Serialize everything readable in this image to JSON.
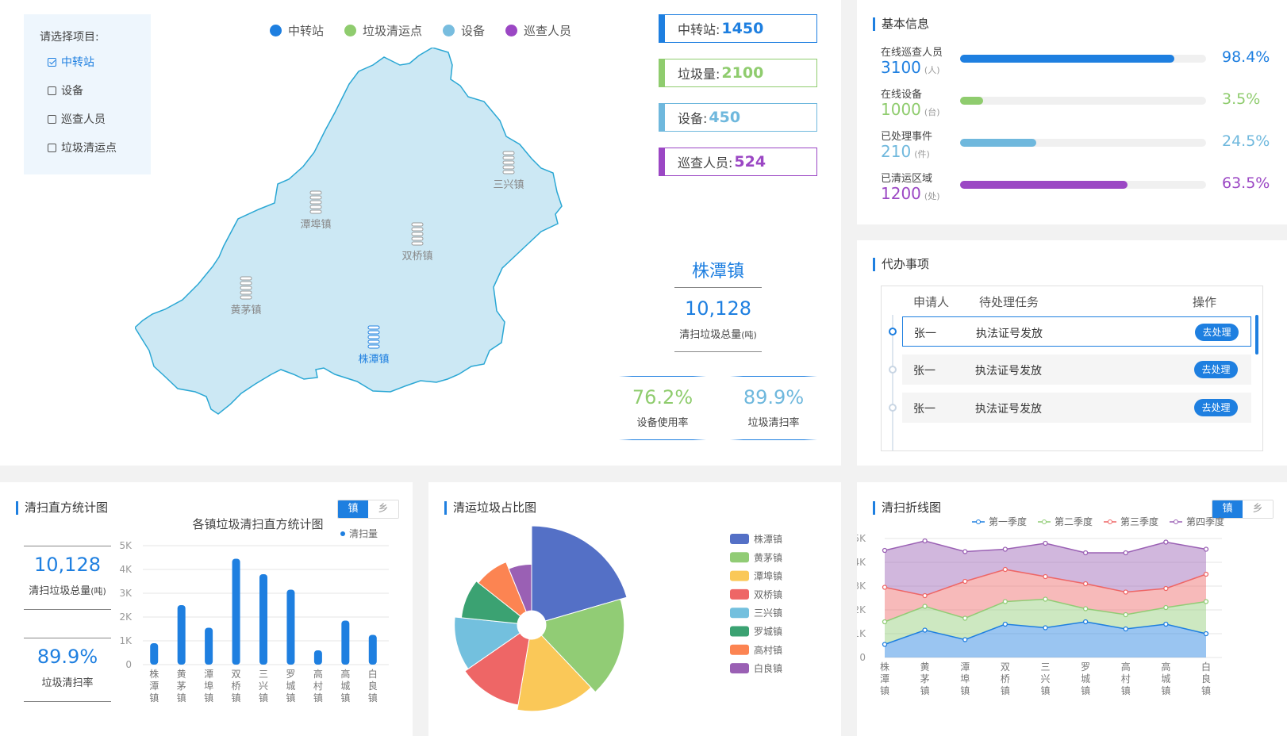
{
  "map_panel": {
    "selector": {
      "label": "请选择项目:",
      "options": [
        {
          "label": "中转站",
          "checked": true
        },
        {
          "label": "设备",
          "checked": false
        },
        {
          "label": "巡查人员",
          "checked": false
        },
        {
          "label": "垃圾清运点",
          "checked": false
        }
      ]
    },
    "legend": [
      {
        "label": "中转站",
        "color": "#1e7fe0"
      },
      {
        "label": "垃圾清运点",
        "color": "#8fcc6e"
      },
      {
        "label": "设备",
        "color": "#78bddf"
      },
      {
        "label": "巡查人员",
        "color": "#9b47c4"
      }
    ],
    "towns": [
      {
        "name": "三兴镇",
        "active": false
      },
      {
        "name": "潭埠镇",
        "active": false
      },
      {
        "name": "双桥镇",
        "active": false
      },
      {
        "name": "黄茅镇",
        "active": false
      },
      {
        "name": "株潭镇",
        "active": true
      }
    ],
    "stats": [
      {
        "label": "中转站:",
        "value": "1450",
        "color": "#1e7fe0"
      },
      {
        "label": "垃圾量:",
        "value": "2100",
        "color": "#8fcc6e"
      },
      {
        "label": "设备:",
        "value": "450",
        "color": "#6fb8dd"
      },
      {
        "label": "巡查人员:",
        "value": "524",
        "color": "#9b47c4"
      }
    ],
    "selected_town": {
      "name": "株潭镇",
      "total": "10,128",
      "total_label": "清扫垃圾总量",
      "total_unit": "(吨)",
      "rate1": "76.2%",
      "rate1_label": "设备使用率",
      "rate2": "89.9%",
      "rate2_label": "垃圾清扫率"
    }
  },
  "basic_info": {
    "title": "基本信息",
    "rows": [
      {
        "name": "在线巡查人员",
        "value": "3100",
        "unit": "(人)",
        "percent": "98.4%",
        "fill": 0.87,
        "color": "#1e7fe0"
      },
      {
        "name": "在线设备",
        "value": "1000",
        "unit": "(台)",
        "percent": "3.5%",
        "fill": 0.095,
        "color": "#8fcc6e"
      },
      {
        "name": "已处理事件",
        "value": "210",
        "unit": "(件)",
        "percent": "24.5%",
        "fill": 0.31,
        "color": "#6fb8dd"
      },
      {
        "name": "已清运区域",
        "value": "1200",
        "unit": "(处)",
        "percent": "63.5%",
        "fill": 0.68,
        "color": "#9b47c4"
      }
    ]
  },
  "todo": {
    "title": "代办事项",
    "headers": [
      "申请人",
      "待处理任务",
      "操作"
    ],
    "rows": [
      {
        "applicant": "张一",
        "task": "执法证号发放",
        "action": "去处理"
      },
      {
        "applicant": "张一",
        "task": "执法证号发放",
        "action": "去处理"
      },
      {
        "applicant": "张一",
        "task": "执法证号发放",
        "action": "去处理"
      }
    ]
  },
  "histogram_panel": {
    "title": "清扫直方统计图",
    "toggle": [
      "镇",
      "乡"
    ],
    "total": "10,128",
    "total_label": "清扫垃圾总量",
    "total_unit": "(吨)",
    "rate": "89.9%",
    "rate_label": "垃圾清扫率"
  },
  "pie_panel": {
    "title": "清运垃圾占比图"
  },
  "line_panel": {
    "title": "清扫折线图",
    "toggle": [
      "镇",
      "乡"
    ]
  },
  "chart_data": [
    {
      "type": "bar",
      "title": "各镇垃圾清扫直方统计图",
      "series": [
        {
          "name": "清扫量",
          "values": [
            900,
            2500,
            1550,
            4450,
            3800,
            3150,
            600,
            1850,
            1250
          ]
        }
      ],
      "categories": [
        "株潭镇",
        "黄茅镇",
        "潭埠镇",
        "双桥镇",
        "三兴镇",
        "罗城镇",
        "高村镇",
        "高城镇",
        "白良镇"
      ],
      "ylim": [
        0,
        5000
      ],
      "yticks": [
        "0",
        "1K",
        "2K",
        "3K",
        "4K",
        "5K"
      ],
      "color": "#1e7fe0"
    },
    {
      "type": "pie",
      "variant": "rose",
      "categories": [
        "株潭镇",
        "黄茅镇",
        "潭埠镇",
        "双桥镇",
        "三兴镇",
        "罗城镇",
        "高村镇",
        "白良镇"
      ],
      "values": [
        100,
        85,
        72,
        62,
        55,
        44,
        40,
        30
      ],
      "colors": [
        "#5470c6",
        "#91cc75",
        "#fac858",
        "#ee6666",
        "#73c0de",
        "#3ba272",
        "#fc8452",
        "#9a60b4"
      ]
    },
    {
      "type": "area",
      "stacked": true,
      "categories": [
        "株潭镇",
        "黄茅镇",
        "潭埠镇",
        "双桥镇",
        "三兴镇",
        "罗城镇",
        "高村镇",
        "高城镇",
        "白良镇"
      ],
      "series": [
        {
          "name": "第一季度",
          "values": [
            550,
            1150,
            750,
            1400,
            1250,
            1500,
            1200,
            1400,
            1000
          ],
          "color": "#1e7fe0"
        },
        {
          "name": "第二季度",
          "values": [
            950,
            1000,
            900,
            950,
            1200,
            550,
            600,
            700,
            1350
          ],
          "color": "#91cc75"
        },
        {
          "name": "第三季度",
          "values": [
            1450,
            450,
            1550,
            1350,
            950,
            1050,
            950,
            800,
            1150
          ],
          "color": "#ee6666"
        },
        {
          "name": "第四季度",
          "values": [
            1550,
            2300,
            1250,
            850,
            1400,
            1300,
            1650,
            1950,
            1050
          ],
          "color": "#9a60b4"
        }
      ],
      "ylim": [
        0,
        5000
      ],
      "yticks": [
        "0",
        "1K",
        "2K",
        "3K",
        "4K",
        "5K"
      ]
    }
  ]
}
